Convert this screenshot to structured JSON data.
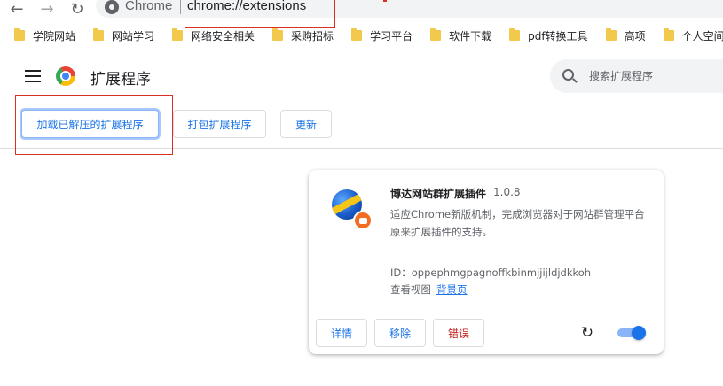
{
  "browser": {
    "omnibox_chip": "Chrome",
    "url": "chrome://extensions"
  },
  "bookmarks": [
    {
      "label": "学院网站",
      "icon": "folder-icon"
    },
    {
      "label": "网站学习",
      "icon": "folder-icon"
    },
    {
      "label": "网络安全相关",
      "icon": "folder-icon"
    },
    {
      "label": "采购招标",
      "icon": "folder-icon"
    },
    {
      "label": "学习平台",
      "icon": "folder-icon"
    },
    {
      "label": "软件下载",
      "icon": "folder-icon"
    },
    {
      "label": "pdf转换工具",
      "icon": "folder-icon"
    },
    {
      "label": "高项",
      "icon": "folder-icon"
    },
    {
      "label": "个人空间",
      "icon": "folder-icon"
    }
  ],
  "header": {
    "title": "扩展程序",
    "search_placeholder": "搜索扩展程序"
  },
  "toolbar": {
    "load_unpacked": "加载已解压的扩展程序",
    "pack": "打包扩展程序",
    "update": "更新"
  },
  "extension": {
    "name": "博达网站群扩展插件",
    "version": "1.0.8",
    "description": "适应Chrome新版机制，完成浏览器对于网站群管理平台原来扩展插件的支持。",
    "id_label": "ID：oppephmgpagnoffkbinmjjijldjdkkoh",
    "views_label": "查看视图",
    "background_link": "背景页",
    "details_button": "详情",
    "remove_button": "移除",
    "errors_button": "错误",
    "enabled": true
  },
  "colors": {
    "accent": "#1a73e8",
    "error": "#c5221f",
    "annotation_red": "#d93025"
  }
}
